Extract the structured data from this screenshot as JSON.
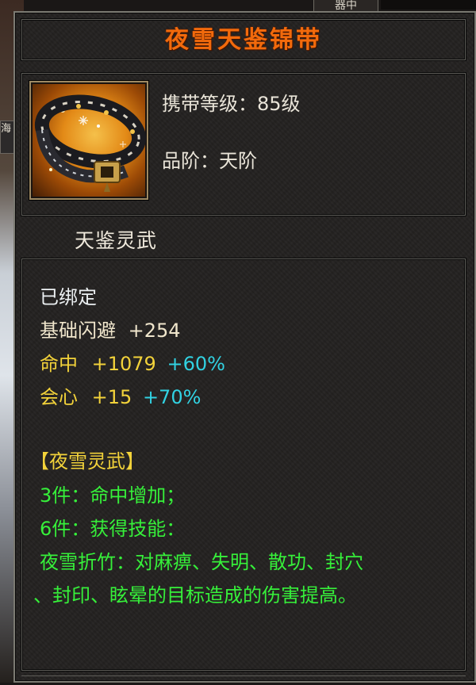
{
  "background": {
    "top_tab_text": "器中",
    "left_label_text": "海"
  },
  "item": {
    "name": "夜雪天鉴锦带",
    "icon": "belt-icon",
    "level_line": "携带等级：85级",
    "grade_line": "品阶：天阶",
    "series": "天鉴灵武"
  },
  "stats": {
    "bound": "已绑定",
    "dodge": {
      "label": "基础闪避",
      "value": "+254"
    },
    "hit": {
      "label": "命中",
      "value": "+1079",
      "bonus": "+60%"
    },
    "crit": {
      "label": "会心",
      "value": "+15",
      "bonus": "+70%"
    }
  },
  "set": {
    "name": "【夜雪灵武】",
    "bonus3": "3件：命中增加；",
    "bonus6": "6件：获得技能：",
    "skill_line1": "夜雪折竹：对麻痹、失明、散功、封穴",
    "skill_line2": "、封印、眩晕的目标造成的伤害提高。"
  },
  "colors": {
    "title": "#f26a0c",
    "stat_label": "#f2d23a",
    "bonus": "#31d2e2",
    "set_text": "#36f03a"
  }
}
